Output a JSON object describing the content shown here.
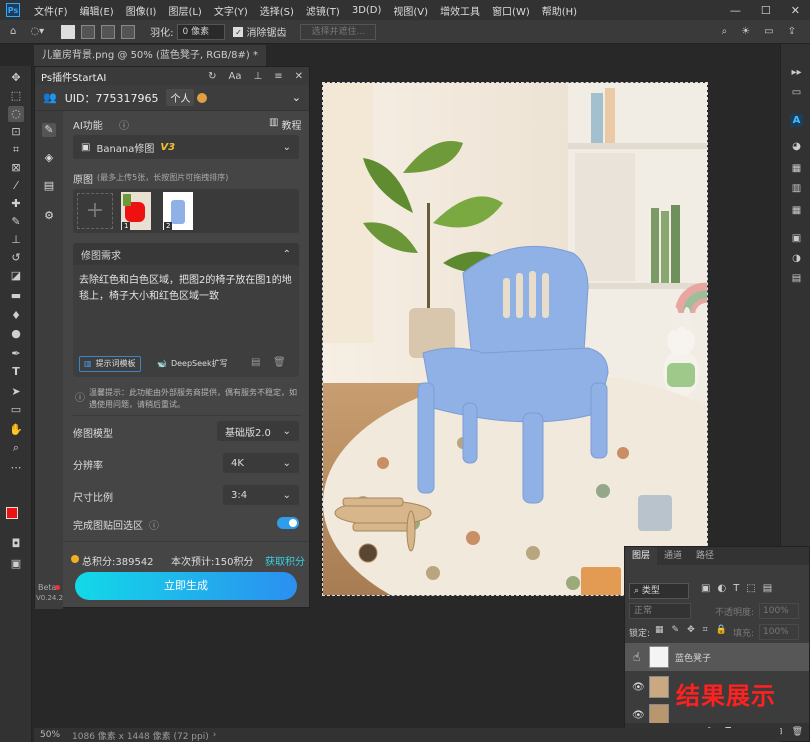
{
  "menu": {
    "logo": "Ps",
    "items": [
      "文件(F)",
      "编辑(E)",
      "图像(I)",
      "图层(L)",
      "文字(Y)",
      "选择(S)",
      "滤镜(T)",
      "3D(D)",
      "视图(V)",
      "增效工具",
      "窗口(W)",
      "帮助(H)"
    ],
    "window_controls": [
      "—",
      "☐",
      "✕"
    ]
  },
  "options": {
    "feather_label": "羽化:",
    "feather_value": "0 像素",
    "antialias_label": "消除锯齿",
    "select_subject": "选择并遮住..."
  },
  "document_tab": "儿童房背景.png @ 50% (蓝色凳子, RGB/8#) *",
  "plugin": {
    "title": "Ps插件StartAI",
    "uid_label": "UID：775317965",
    "account_type": "个人",
    "ai_function_label": "AI功能",
    "tutorial_label": "教程",
    "function_select": "Banana修图",
    "function_version": "V3",
    "source_label": "原图",
    "source_hint": "(最多上传5张，长按图片可拖拽排序)",
    "thumb1_index": "1",
    "thumb2_index": "2",
    "requirement_label": "修图需求",
    "requirement_text": "去除红色和白色区域，把图2的椅子放在图1的地毯上，椅子大小和红色区域一致",
    "prompt_template_btn": "提示词模板",
    "deepseek_btn": "DeepSeek扩写",
    "warning": "温馨提示：此功能由外部服务商提供，偶有服务不稳定，如遇使用问题，请稍后重试。",
    "model_label": "修图模型",
    "model_value": "基础版2.0",
    "resolution_label": "分辨率",
    "resolution_value": "4K",
    "ratio_label": "尺寸比例",
    "ratio_value": "3:4",
    "paste_back_label": "完成图贴回选区",
    "paste_back_on": true,
    "points_text": "总积分:389542",
    "estimate_text": "本次预计:150积分",
    "get_points": "获取积分",
    "generate_btn": "立即生成",
    "beta_label": "Beta",
    "version_label": "V0.24.2"
  },
  "layers": {
    "tabs": [
      "图层",
      "通道",
      "路径"
    ],
    "filter_label": "类型",
    "blend_mode": "正常",
    "opacity_label": "不透明度:",
    "opacity_value": "100%",
    "lock_label": "锁定:",
    "fill_label": "填充:",
    "fill_value": "100%",
    "layer1_name": "蓝色凳子",
    "layer3_name": "结果展示"
  },
  "status": {
    "zoom": "50%",
    "size": "1086 像素 x 1448 像素 (72 ppi)"
  }
}
